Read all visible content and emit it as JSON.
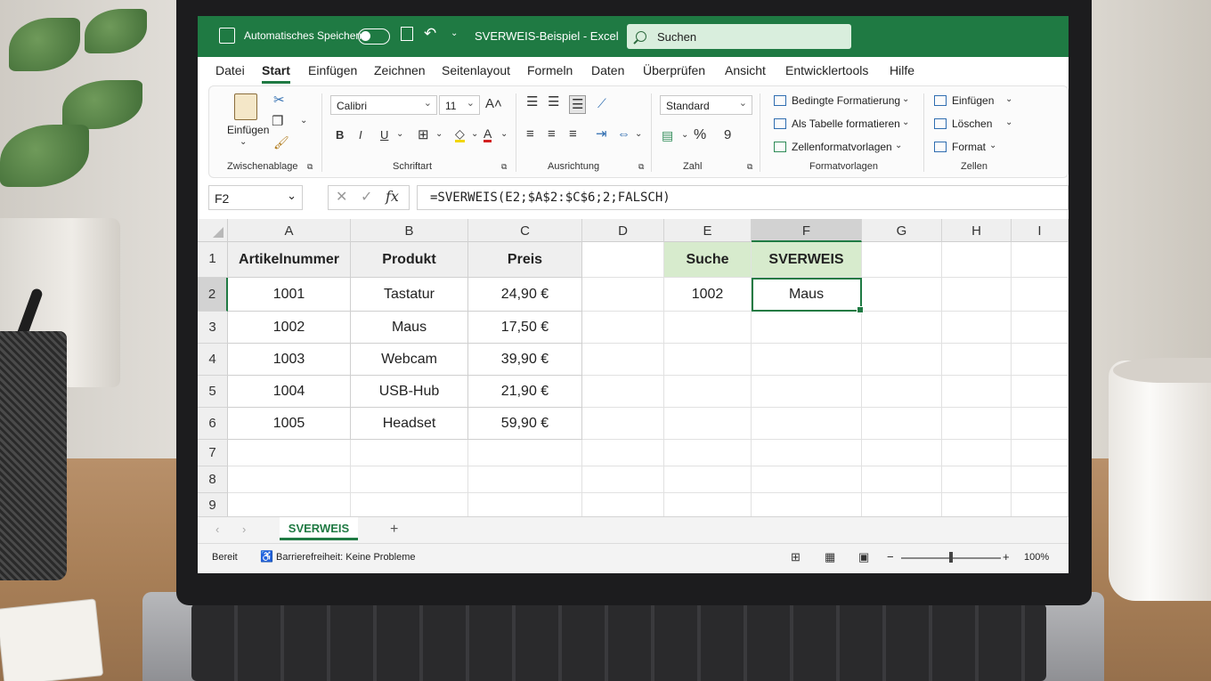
{
  "titlebar": {
    "autosave_label": "Automatisches Speichern",
    "doc_title": "SVERWEIS-Beispiel - Excel",
    "search_placeholder": "Suchen"
  },
  "menu_tabs": [
    "Datei",
    "Start",
    "Einfügen",
    "Zeichnen",
    "Seitenlayout",
    "Formeln",
    "Daten",
    "Überprüfen",
    "Ansicht",
    "Entwicklertools",
    "Hilfe"
  ],
  "active_tab": "Start",
  "ribbon": {
    "clipboard": {
      "paste_label": "Einfügen",
      "group_label": "Zwischenablage"
    },
    "font": {
      "name": "Calibri",
      "size": "11",
      "group_label": "Schriftart"
    },
    "alignment": {
      "group_label": "Ausrichtung"
    },
    "number": {
      "format": "Standard",
      "group_label": "Zahl"
    },
    "styles": {
      "conditional": "Bedingte Formatierung",
      "as_table": "Als Tabelle formatieren",
      "cell_styles": "Zellenformatvorlagen",
      "group_label": "Formatvorlagen"
    },
    "cells": {
      "insert": "Einfügen",
      "delete": "Löschen",
      "format": "Format",
      "group_label": "Zellen"
    }
  },
  "formula_bar": {
    "name_box": "F2",
    "formula": "=SVERWEIS(E2;$A$2:$C$6;2;FALSCH)"
  },
  "grid": {
    "columns": [
      "A",
      "B",
      "C",
      "D",
      "E",
      "F",
      "G",
      "H",
      "I"
    ],
    "rows": [
      "1",
      "2",
      "3",
      "4",
      "5",
      "6",
      "7",
      "8",
      "9"
    ],
    "table_headers": [
      "Artikelnummer",
      "Produkt",
      "Preis"
    ],
    "table_rows": [
      [
        "1001",
        "Tastatur",
        "24,90 €"
      ],
      [
        "1002",
        "Maus",
        "17,50 €"
      ],
      [
        "1003",
        "Webcam",
        "39,90 €"
      ],
      [
        "1004",
        "USB-Hub",
        "21,90 €"
      ],
      [
        "1005",
        "Headset",
        "59,90 €"
      ]
    ],
    "lookup_header": "Suche",
    "result_header": "SVERWEIS",
    "lookup_value": "1002",
    "result_value": "Maus",
    "active_cell": "F2"
  },
  "sheet_tabs": {
    "active": "SVERWEIS",
    "add": "+"
  },
  "status": {
    "ready": "Bereit",
    "accessibility": "Barrierefreiheit: Keine Probleme",
    "zoom": "100%",
    "zoom_minus": "−",
    "zoom_plus": "+"
  },
  "colors": {
    "excel_green": "#1f7a43",
    "header_green": "#d7ebcd"
  },
  "icons": [
    "save-icon",
    "undo-icon",
    "search-icon",
    "paste-icon",
    "cut-icon",
    "copy-icon",
    "format-painter-icon",
    "bold-icon",
    "italic-icon",
    "underline-icon",
    "borders-icon",
    "fill-color-icon",
    "font-color-icon",
    "align-icons",
    "wrap-icon",
    "merge-icon",
    "currency-icon",
    "percent-icon",
    "comma-icon",
    "conditional-format-icon",
    "table-icon",
    "cell-styles-icon",
    "insert-cells-icon",
    "delete-cells-icon",
    "format-cells-icon",
    "cancel-icon",
    "confirm-icon",
    "fx-icon",
    "normal-view-icon",
    "page-layout-icon",
    "page-break-icon"
  ]
}
